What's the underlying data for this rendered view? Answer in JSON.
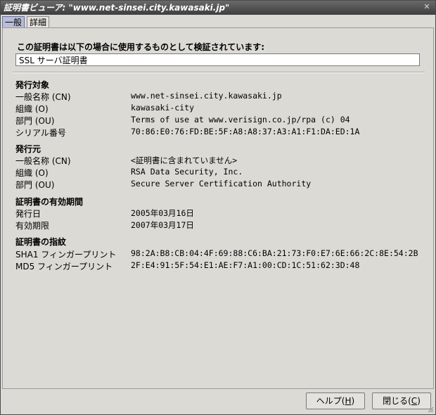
{
  "window": {
    "title": "証明書ビューア: \"www.net-sinsei.city.kawasaki.jp\"",
    "close_glyph": "✕"
  },
  "tabs": [
    {
      "label": "一般"
    },
    {
      "label": "詳細"
    }
  ],
  "general": {
    "heading": "この証明書は以下の場合に使用するものとして検証されています:",
    "usage": "SSL サーバ証明書",
    "subject": {
      "title": "発行対象",
      "rows": [
        {
          "label": "一般名称 (CN)",
          "value": "www.net-sinsei.city.kawasaki.jp"
        },
        {
          "label": "組織 (O)",
          "value": "kawasaki-city"
        },
        {
          "label": "部門 (OU)",
          "value": "Terms of use at www.verisign.co.jp/rpa (c) 04"
        },
        {
          "label": "シリアル番号",
          "value": "70:86:E0:76:FD:BE:5F:A8:A8:37:A3:A1:F1:DA:ED:1A"
        }
      ]
    },
    "issuer": {
      "title": "発行元",
      "rows": [
        {
          "label": "一般名称 (CN)",
          "value": "<証明書に含まれていません>"
        },
        {
          "label": "組織 (O)",
          "value": "RSA Data Security, Inc."
        },
        {
          "label": "部門 (OU)",
          "value": "Secure Server Certification Authority"
        }
      ]
    },
    "validity": {
      "title": "証明書の有効期間",
      "rows": [
        {
          "label": "発行日",
          "value": "2005年03月16日"
        },
        {
          "label": "有効期限",
          "value": "2007年03月17日"
        }
      ]
    },
    "fingerprints": {
      "title": "証明書の指紋",
      "rows": [
        {
          "label": "SHA1 フィンガープリント",
          "value": "98:2A:B8:CB:04:4F:69:88:C6:BA:21:73:F0:E7:6E:66:2C:8E:54:2B"
        },
        {
          "label": "MD5 フィンガープリント",
          "value": "2F:E4:91:5F:54:E1:AE:F7:A1:00:CD:1C:51:62:3D:48"
        }
      ]
    }
  },
  "buttons": {
    "help_label": "ヘルプ(",
    "help_key": "H",
    "close_label": "閉じる(",
    "close_key": "C",
    "paren_close": ")"
  }
}
